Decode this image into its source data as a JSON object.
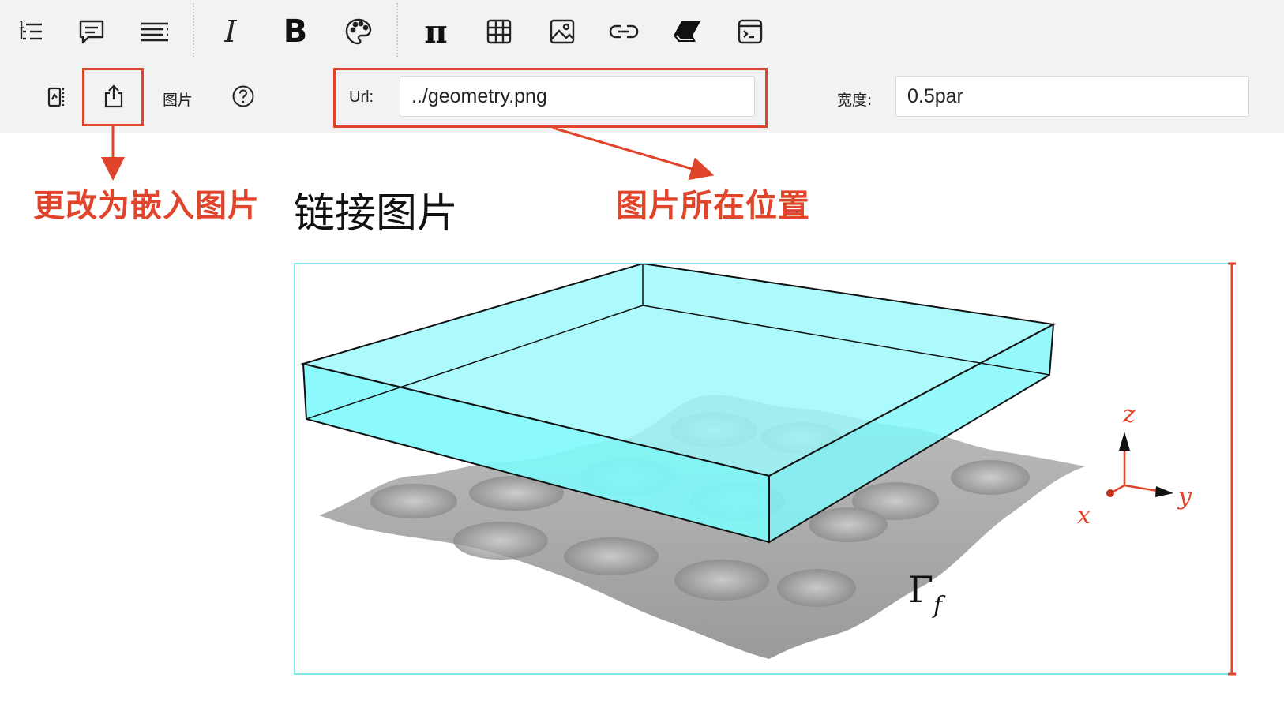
{
  "toolbar": {
    "icons": [
      "list-outline-icon",
      "comment-icon",
      "paragraph-align-icon",
      "italic-icon",
      "bold-icon",
      "palette-icon",
      "pi-icon",
      "table-icon",
      "image-icon",
      "link-icon",
      "eraser-icon",
      "code-block-icon"
    ],
    "bold_glyph": "B",
    "italic_glyph": "I",
    "pi_glyph": "π"
  },
  "image_panel": {
    "tab_label": "图片",
    "url_label": "Url:",
    "url_value": "../geometry.png",
    "width_label": "宽度:",
    "width_value": "0.5par"
  },
  "annotations": {
    "embed_change": "更改为嵌入图片",
    "image_location": "图片所在位置"
  },
  "content": {
    "heading": "链接图片"
  },
  "figure": {
    "gamma_symbol": "Γ",
    "gamma_subscript": "f",
    "axis_z": "z",
    "axis_y": "y",
    "axis_x": "x",
    "colors": {
      "slab": "#7ff9fb",
      "surface": "#9e9e9e",
      "frame": "#7ee8ea",
      "annotation": "#e0442b"
    }
  }
}
